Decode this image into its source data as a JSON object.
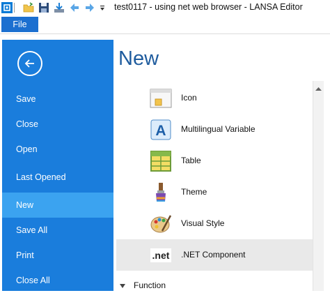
{
  "window": {
    "title": "test0117 - using net web browser - LANSA Editor"
  },
  "quick_access": [
    {
      "name": "app-logo-icon"
    },
    {
      "name": "open-folder-icon"
    },
    {
      "name": "save-icon"
    },
    {
      "name": "download-icon"
    },
    {
      "name": "back-arrow-icon"
    },
    {
      "name": "forward-arrow-icon"
    },
    {
      "name": "customize-dropdown-icon"
    }
  ],
  "ribbon": {
    "file_tab": "File"
  },
  "sidebar": {
    "items": [
      {
        "label": "Save"
      },
      {
        "label": "Close"
      },
      {
        "label": "Open"
      },
      {
        "label": "Last Opened"
      },
      {
        "label": "New",
        "selected": true
      },
      {
        "label": "Save All"
      },
      {
        "label": "Print"
      },
      {
        "label": "Close All"
      }
    ]
  },
  "content": {
    "title": "New",
    "items": [
      {
        "label": "Icon",
        "icon": "icon-file-icon"
      },
      {
        "label": "Multilingual Variable",
        "icon": "multilingual-variable-icon"
      },
      {
        "label": "Table",
        "icon": "table-icon"
      },
      {
        "label": "Theme",
        "icon": "theme-brush-icon"
      },
      {
        "label": "Visual Style",
        "icon": "palette-icon"
      },
      {
        "label": ".NET Component",
        "icon": "dotnet-icon",
        "selected": true
      }
    ],
    "section_header": "Function",
    "dotnet_badge": ".net",
    "multilingual_letter": "A"
  },
  "colors": {
    "sidebar_bg": "#1a7ddc",
    "sidebar_selected": "#3ba3f0",
    "title_blue": "#1f5c9e",
    "file_tab": "#1b6fd0"
  }
}
